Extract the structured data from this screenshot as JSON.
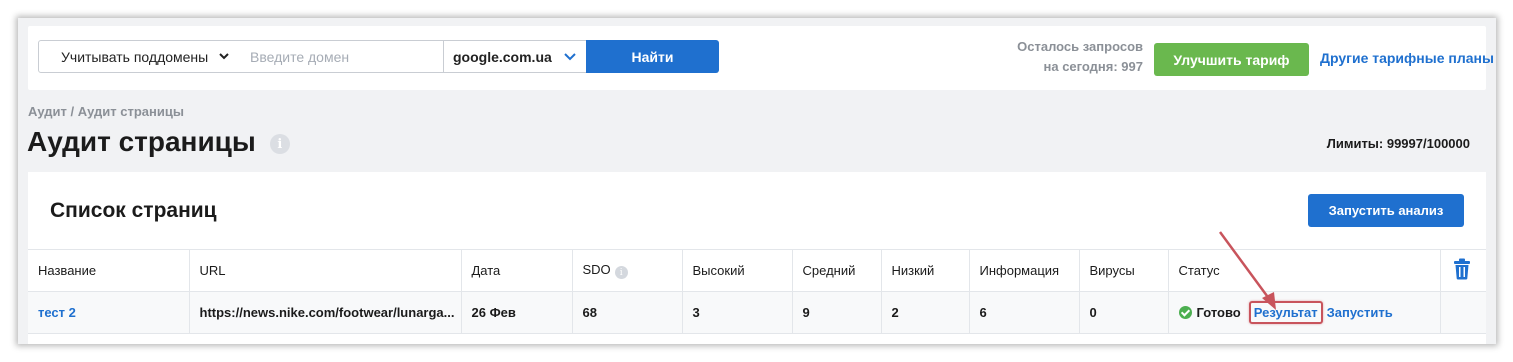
{
  "topbar": {
    "subdomains_label": "Учитывать поддомены",
    "domain_placeholder": "Введите домен",
    "domain_value": "",
    "engine_value": "google.com.ua",
    "search_label": "Найти",
    "quota_line1": "Осталось запросов",
    "quota_line2": "на сегодня: 997",
    "upgrade_label": "Улучшить тариф",
    "plans_label": "Другие тарифные планы"
  },
  "breadcrumb": "Аудит / Аудит страницы",
  "page_title": "Аудит страницы",
  "info_glyph": "i",
  "limits": "Лимиты: 99997/100000",
  "card": {
    "title": "Список страниц",
    "run_label": "Запустить анализ"
  },
  "table": {
    "headers": {
      "name": "Название",
      "url": "URL",
      "date": "Дата",
      "sdo": "SDO",
      "high": "Высокий",
      "medium": "Средний",
      "low": "Низкий",
      "info": "Информация",
      "viruses": "Вирусы",
      "status": "Статус"
    },
    "rows": [
      {
        "name": "тест 2",
        "url": "https://news.nike.com/footwear/lunarga...",
        "date": "26 Фев",
        "sdo": "68",
        "high": "3",
        "medium": "9",
        "low": "2",
        "info": "6",
        "viruses": "0",
        "status": "Готово",
        "result_label": "Результат",
        "run_label": "Запустить"
      }
    ]
  },
  "colors": {
    "primary": "#1f70cf",
    "success": "#6ab84e",
    "highlight": "#c8545c"
  },
  "icons": [
    "chevron-down-icon",
    "info-icon",
    "check-circle-icon",
    "trash-icon",
    "annotation-arrow"
  ]
}
